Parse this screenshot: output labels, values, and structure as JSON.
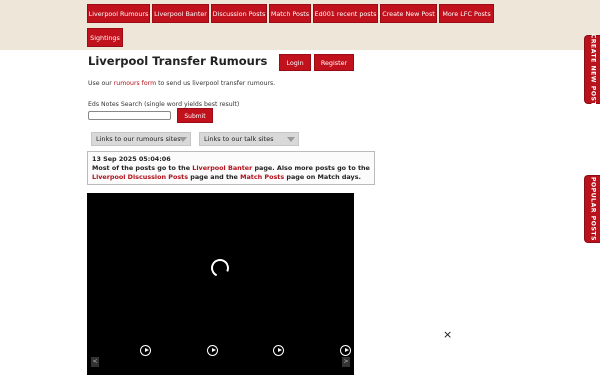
{
  "nav": {
    "items": [
      {
        "label": "Liverpool Rumours"
      },
      {
        "label": "Liverpool Banter"
      },
      {
        "label": "Discussion Posts"
      },
      {
        "label": "Match Posts"
      },
      {
        "label": "Ed001 recent posts"
      },
      {
        "label": "Create New Post"
      },
      {
        "label": "More LFC Posts"
      },
      {
        "label": "Sightings"
      }
    ]
  },
  "header": {
    "title": "Liverpool Transfer Rumours",
    "login_label": "Login",
    "register_label": "Register"
  },
  "intro": {
    "prefix": "Use our ",
    "link": "rumours form",
    "suffix": " to send us liverpool transfer rumours."
  },
  "search": {
    "label": "Eds Notes Search (single word yields best result)",
    "value": "",
    "submit_label": "Submit"
  },
  "dropdowns": {
    "rumours_sites": "Links to our rumours sites",
    "talk_sites": "Links to our talk sites"
  },
  "news": {
    "timestamp": "13 Sep 2025 05:04:06",
    "text1": "Most of the posts go to the ",
    "link1": "Liverpool Banter",
    "text2": " page. Also more posts go to the",
    "link2": "Liverpool Discussion Posts",
    "text3": " page and the ",
    "link3": "Match Posts",
    "text4": " page on Match days."
  },
  "video": {
    "prev": "<",
    "next": ">"
  },
  "overlay": {
    "close": "×"
  },
  "side_tabs": {
    "create": "CREATE NEW POST",
    "popular": "POPULAR POSTS"
  },
  "colors": {
    "brand_red": "#c0111c",
    "top_band": "#efe6da"
  }
}
